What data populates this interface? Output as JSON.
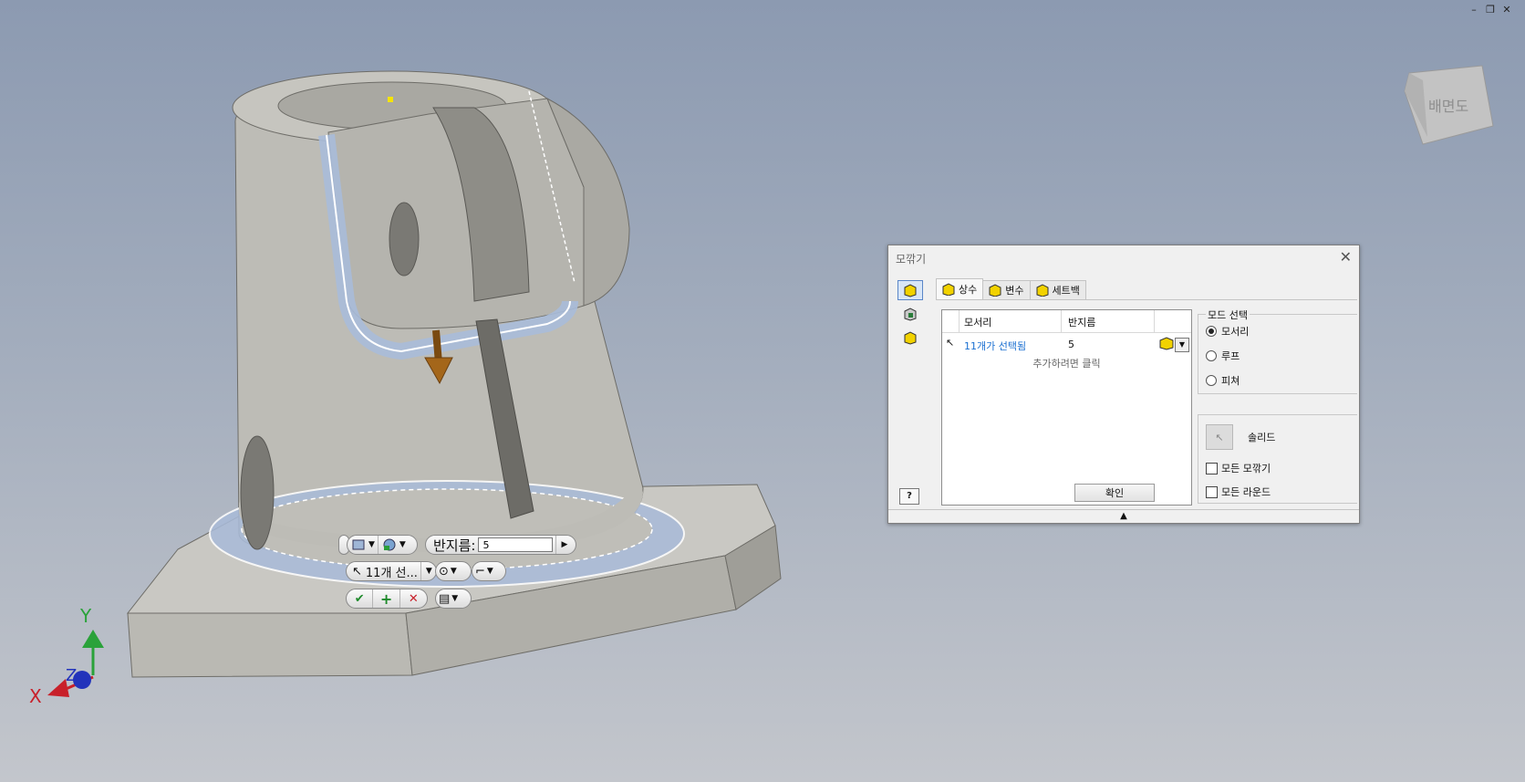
{
  "window": {
    "controls": [
      "–",
      "❐",
      "✕"
    ]
  },
  "viewcube": {
    "label": "배면도"
  },
  "axes": {
    "x": "X",
    "y": "Y",
    "z": "Z"
  },
  "minitoolbar": {
    "radius_label": "반지름:",
    "radius_value": "5",
    "selection_label": "11개 선...",
    "apply_icon": "checkmark-icon",
    "add_icon": "plus-icon",
    "cancel_icon": "x-icon"
  },
  "dialog": {
    "title": "모깎기",
    "tabs": [
      {
        "label": "상수",
        "active": true
      },
      {
        "label": "변수",
        "active": false
      },
      {
        "label": "세트백",
        "active": false
      }
    ],
    "grid": {
      "col_edges": "모서리",
      "col_radius": "반지름",
      "row": {
        "edges": "11개가 선택됨",
        "radius": "5"
      },
      "add_hint": "추가하려면 클릭"
    },
    "ok_button": "확인",
    "mode_group": {
      "title": "모드 선택",
      "options": [
        {
          "label": "모서리",
          "checked": true
        },
        {
          "label": "루프",
          "checked": false
        },
        {
          "label": "피쳐",
          "checked": false
        }
      ]
    },
    "solid_label": "솔리드",
    "checkboxes": [
      {
        "label": "모든 모깎기",
        "checked": false
      },
      {
        "label": "모든 라운드",
        "checked": false
      }
    ],
    "help_label": "?",
    "expand_glyph": "▲"
  },
  "colors": {
    "selection_highlight": "#aebfdc",
    "part_body": "#c4c3bd",
    "link_blue": "#1a6fd1",
    "axis_x": "#c8202a",
    "axis_y": "#2aa23a",
    "axis_z": "#2233bb"
  }
}
